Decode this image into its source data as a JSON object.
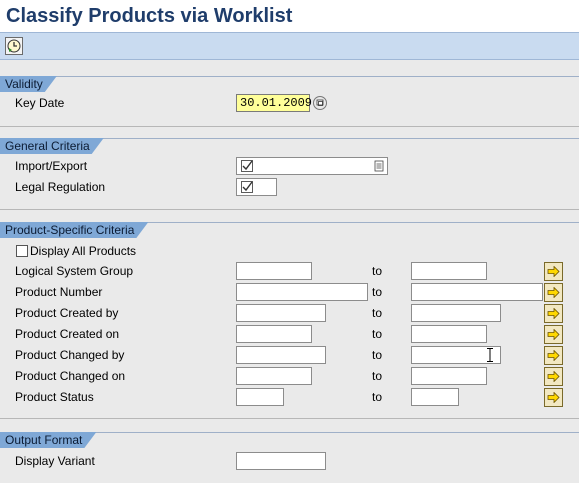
{
  "title": "Classify Products via Worklist",
  "toolbar": {
    "execute_icon": "execute-clock-icon"
  },
  "validity": {
    "header": "Validity",
    "key_date_label": "Key Date",
    "key_date_value": "30.01.2009"
  },
  "general": {
    "header": "General Criteria",
    "import_export_label": "Import/Export",
    "legal_regulation_label": "Legal Regulation"
  },
  "product": {
    "header": "Product-Specific Criteria",
    "display_all_label": "Display All Products",
    "to_label": "to",
    "rows": [
      {
        "label": "Logical System Group"
      },
      {
        "label": "Product Number"
      },
      {
        "label": "Product Created by"
      },
      {
        "label": "Product Created on"
      },
      {
        "label": "Product Changed by"
      },
      {
        "label": "Product Changed on"
      },
      {
        "label": "Product Status"
      }
    ]
  },
  "output": {
    "header": "Output Format",
    "display_variant_label": "Display Variant"
  },
  "colors": {
    "title": "#1f3d6b",
    "section_header": "#7fa8d6",
    "toolbar": "#c9dbf0",
    "date_bg": "#ffff99"
  }
}
